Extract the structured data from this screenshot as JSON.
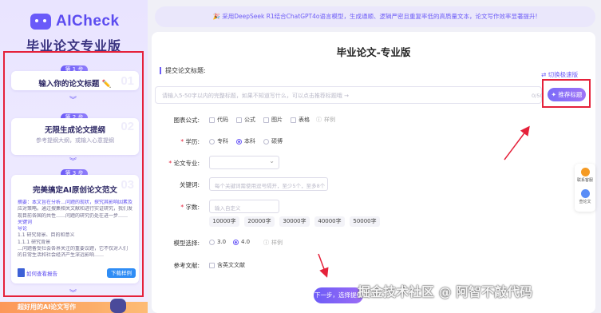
{
  "brand": {
    "logo_text": "AICheck",
    "product_title": "毕业论文专业版"
  },
  "steps": [
    {
      "pill": "第 1 步",
      "title": "输入你的论文标题 ✏️",
      "num": "01",
      "subtitle": ""
    },
    {
      "pill": "第 2 步",
      "title": "无限生成论文提纲",
      "num": "02",
      "subtitle": "参考提纲大纲，或输入心意提纲"
    },
    {
      "pill": "第 3 步",
      "title": "完美搞定AI原创论文范文",
      "num": "03",
      "subtitle": ""
    }
  ],
  "sample_lines": [
    "摘要：本文旨在分析…问题的现状，探究其影响因素及",
    "应对策略。通过搜集相关文献和进行实证研究，我们发",
    "现目前各国的共性……问题的研究仍处在进一步……",
    "关键词",
    "导论",
    "1.1 研究背景、目的和意义",
    "1.1.1 研究背景",
    "…问题备受社会各界关注的重要议题，它不仅对人们",
    "的日常生活和社会经济产生深远影响……"
  ],
  "sample_footer": {
    "detail": "如何查看报告",
    "download": "下载样例"
  },
  "bottom_strip": "超好用的AI论文写作",
  "banner": "🎉 采用DeepSeek R1结合ChatGPT4o语言模型，生成通顺、逻辑严密且重复率低的高质量文本，论文写作效率显著提升!",
  "main": {
    "title": "毕业论文-专业版",
    "topic_label": "提交论文标题:",
    "switch_link": "⇄ 切换极速版",
    "topic_placeholder": "请输入5-50字以内的完整标题，如果不知道写什么，可以点击推荐标题哦 →",
    "topic_count": "0/50",
    "recommend_btn": "✦ 推荐标题"
  },
  "form": {
    "charts_label": "图表公式:",
    "charts_opts": [
      "代码",
      "公式",
      "图片",
      "表格"
    ],
    "charts_example": "样例",
    "degree_label": "学历:",
    "degree_opts": [
      "专科",
      "本科",
      "硕博"
    ],
    "degree_selected": "本科",
    "major_label": "论文专业:",
    "major_placeholder": "",
    "keywords_label": "关键词:",
    "keywords_placeholder": "每个关键词需使用逗号隔开，至少5个，至多8个",
    "words_label": "字数:",
    "words_placeholder": "输入自定义",
    "word_options": [
      "10000字",
      "20000字",
      "30000字",
      "40000字",
      "50000字"
    ],
    "model_label": "模型选择:",
    "model_opts": [
      "3.0",
      "4.0"
    ],
    "model_selected": "4.0",
    "model_example": "样例",
    "refs_label": "参考文献:",
    "refs_opt": "含英文文献"
  },
  "next_btn": "下一步，选择提纲",
  "float": {
    "item1": "联系客服",
    "item2": "查论文"
  },
  "watermark": "掘金技术社区 @ 阿智不敲代码",
  "colors": {
    "accent": "#6d5cf7",
    "annotation_red": "#e5213a",
    "download_blue": "#2f8df5"
  }
}
